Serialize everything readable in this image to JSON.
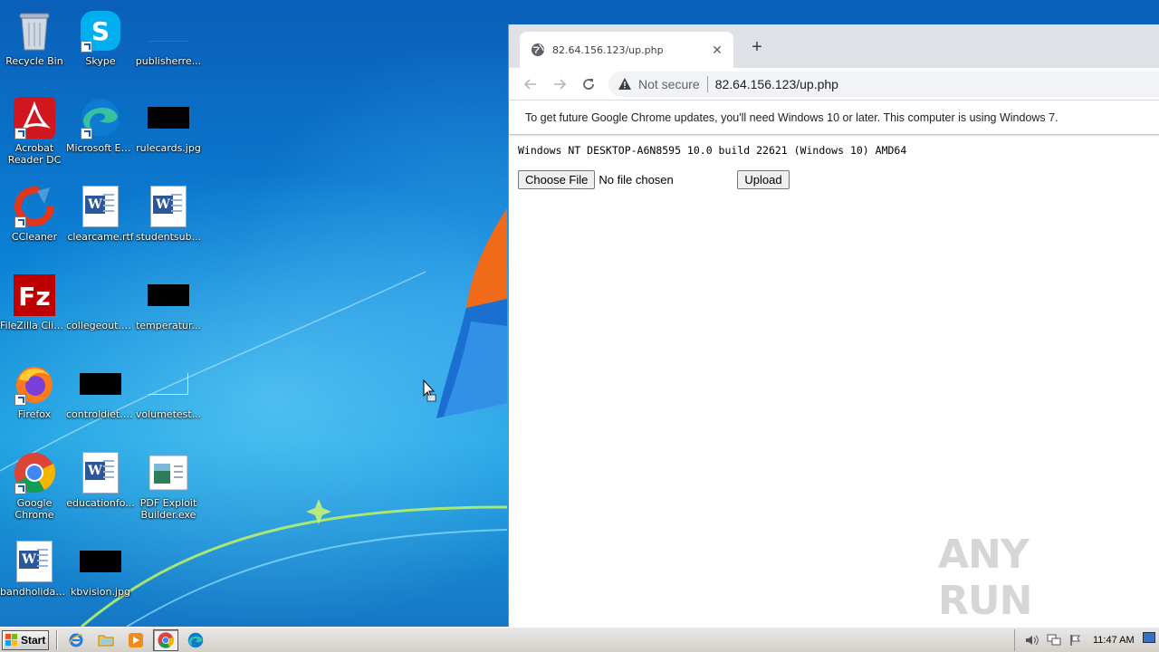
{
  "desktop": {
    "icons": [
      {
        "label": "Recycle Bin"
      },
      {
        "label": "Skype"
      },
      {
        "label": "publisherre..."
      },
      {
        "label": "Acrobat Reader DC"
      },
      {
        "label": "Microsoft Edge"
      },
      {
        "label": "rulecards.jpg"
      },
      {
        "label": "CCleaner"
      },
      {
        "label": "clearcame.rtf"
      },
      {
        "label": "studentsub..."
      },
      {
        "label": "FileZilla Client"
      },
      {
        "label": "collegeout.png"
      },
      {
        "label": "temperatur..."
      },
      {
        "label": "Firefox"
      },
      {
        "label": "controldiet.jpg"
      },
      {
        "label": "volumetest..."
      },
      {
        "label": "Google Chrome"
      },
      {
        "label": "educationfo..."
      },
      {
        "label": "PDF Exploit Builder.exe"
      },
      {
        "label": "bandholiday..."
      },
      {
        "label": "kbvision.jpg"
      }
    ]
  },
  "browser": {
    "tab_title": "82.64.156.123/up.php",
    "tab_close": "✕",
    "new_tab": "+",
    "security_label": "Not secure",
    "url": "82.64.156.123/up.php",
    "infobar_text": "To get future Google Chrome updates, you'll need Windows 10 or later. This computer is using Windows 7.",
    "page": {
      "system_info": "Windows NT DESKTOP-A6N8595 10.0 build 22621 (Windows 10) AMD64",
      "choose_file_label": "Choose File",
      "no_file_text": "No file chosen",
      "upload_label": "Upload"
    }
  },
  "watermark": "ANY RUN",
  "taskbar": {
    "start_label": "Start",
    "clock": "11:47 AM"
  }
}
